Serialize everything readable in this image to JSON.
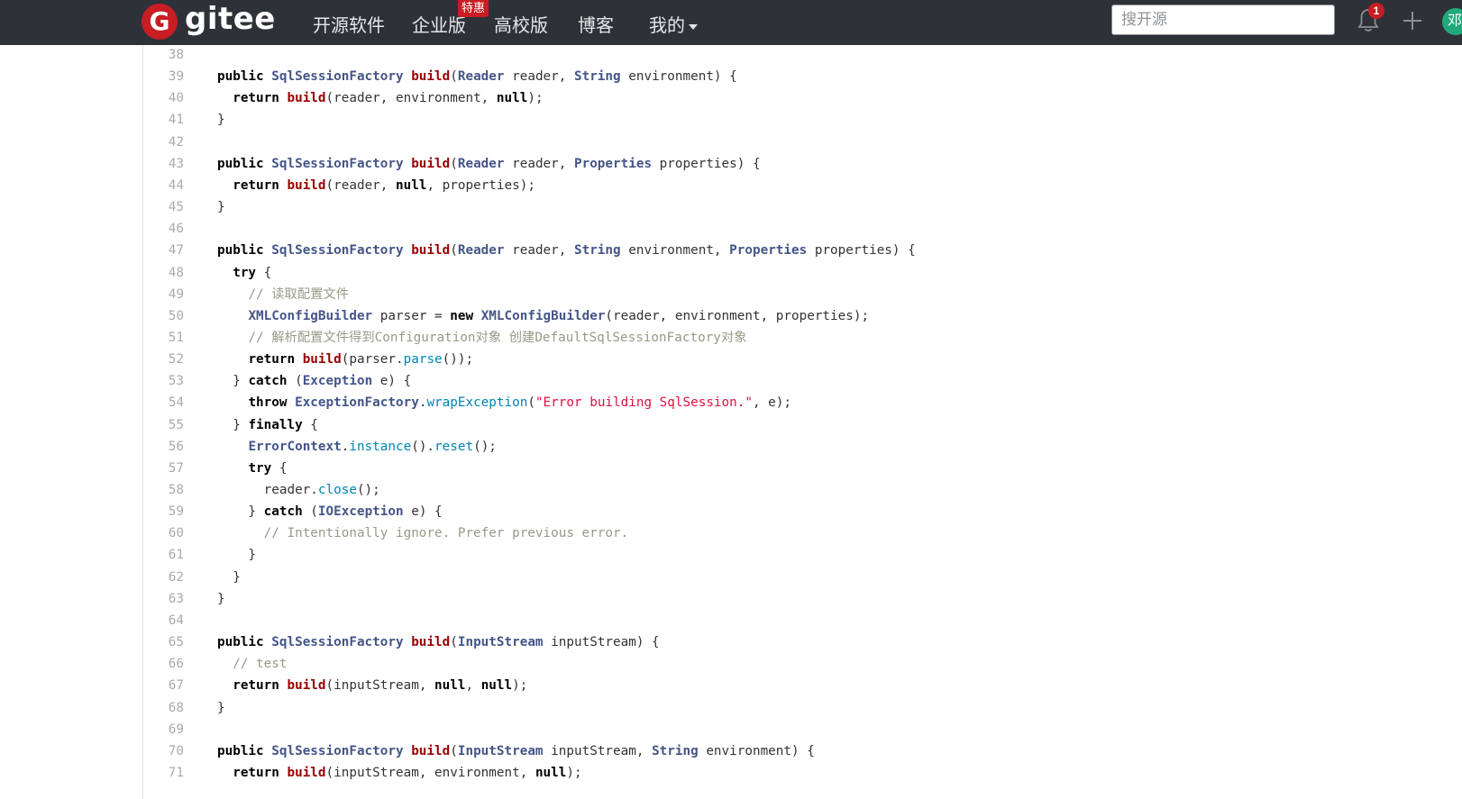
{
  "header": {
    "logo_letter": "G",
    "logo_text": "gitee",
    "nav": [
      "开源软件",
      "企业版",
      "高校版",
      "博客",
      "我的"
    ],
    "badge": "特惠",
    "search_placeholder": "搜开源",
    "notification_count": "1",
    "avatar_text": "邓"
  },
  "code": {
    "lines": [
      {
        "n": "38",
        "t": []
      },
      {
        "n": "39",
        "t": [
          [
            "kw",
            "public "
          ],
          [
            "ty",
            "SqlSessionFactory "
          ],
          [
            "fn",
            "build"
          ],
          [
            "",
            "("
          ],
          [
            "ty",
            "Reader"
          ],
          [
            "",
            " reader, "
          ],
          [
            "ty",
            "String"
          ],
          [
            "",
            " environment) {"
          ]
        ]
      },
      {
        "n": "40",
        "t": [
          [
            "",
            "  "
          ],
          [
            "kw",
            "return "
          ],
          [
            "fn",
            "build"
          ],
          [
            "",
            "(reader, environment, "
          ],
          [
            "kw",
            "null"
          ],
          [
            "",
            ");"
          ]
        ]
      },
      {
        "n": "41",
        "t": [
          [
            "",
            "}"
          ]
        ]
      },
      {
        "n": "42",
        "t": []
      },
      {
        "n": "43",
        "t": [
          [
            "kw",
            "public "
          ],
          [
            "ty",
            "SqlSessionFactory "
          ],
          [
            "fn",
            "build"
          ],
          [
            "",
            "("
          ],
          [
            "ty",
            "Reader"
          ],
          [
            "",
            " reader, "
          ],
          [
            "ty",
            "Properties"
          ],
          [
            "",
            " properties) {"
          ]
        ]
      },
      {
        "n": "44",
        "t": [
          [
            "",
            "  "
          ],
          [
            "kw",
            "return "
          ],
          [
            "fn",
            "build"
          ],
          [
            "",
            "(reader, "
          ],
          [
            "kw",
            "null"
          ],
          [
            "",
            ", properties);"
          ]
        ]
      },
      {
        "n": "45",
        "t": [
          [
            "",
            "}"
          ]
        ]
      },
      {
        "n": "46",
        "t": []
      },
      {
        "n": "47",
        "t": [
          [
            "kw",
            "public "
          ],
          [
            "ty",
            "SqlSessionFactory "
          ],
          [
            "fn",
            "build"
          ],
          [
            "",
            "("
          ],
          [
            "ty",
            "Reader"
          ],
          [
            "",
            " reader, "
          ],
          [
            "ty",
            "String"
          ],
          [
            "",
            " environment, "
          ],
          [
            "ty",
            "Properties"
          ],
          [
            "",
            " properties) {"
          ]
        ]
      },
      {
        "n": "48",
        "t": [
          [
            "",
            "  "
          ],
          [
            "kw",
            "try"
          ],
          [
            "",
            " {"
          ]
        ]
      },
      {
        "n": "49",
        "t": [
          [
            "",
            "    "
          ],
          [
            "cm",
            "// 读取配置文件"
          ]
        ]
      },
      {
        "n": "50",
        "t": [
          [
            "",
            "    "
          ],
          [
            "ty",
            "XMLConfigBuilder"
          ],
          [
            "",
            " parser = "
          ],
          [
            "kw",
            "new "
          ],
          [
            "ty",
            "XMLConfigBuilder"
          ],
          [
            "",
            "(reader, environment, properties);"
          ]
        ]
      },
      {
        "n": "51",
        "t": [
          [
            "",
            "    "
          ],
          [
            "cm",
            "// 解析配置文件得到Configuration对象 创建DefaultSqlSessionFactory对象"
          ]
        ]
      },
      {
        "n": "52",
        "t": [
          [
            "",
            "    "
          ],
          [
            "kw",
            "return "
          ],
          [
            "fn",
            "build"
          ],
          [
            "",
            "(parser."
          ],
          [
            "mt",
            "parse"
          ],
          [
            "",
            "());"
          ]
        ]
      },
      {
        "n": "53",
        "t": [
          [
            "",
            "  } "
          ],
          [
            "kw",
            "catch"
          ],
          [
            "",
            " ("
          ],
          [
            "ty",
            "Exception"
          ],
          [
            "",
            " e) {"
          ]
        ]
      },
      {
        "n": "54",
        "t": [
          [
            "",
            "    "
          ],
          [
            "kw",
            "throw "
          ],
          [
            "ty",
            "ExceptionFactory"
          ],
          [
            "",
            "."
          ],
          [
            "mt",
            "wrapException"
          ],
          [
            "",
            "("
          ],
          [
            "st",
            "\"Error building SqlSession.\""
          ],
          [
            "",
            ", e);"
          ]
        ]
      },
      {
        "n": "55",
        "t": [
          [
            "",
            "  } "
          ],
          [
            "kw",
            "finally"
          ],
          [
            "",
            " {"
          ]
        ]
      },
      {
        "n": "56",
        "t": [
          [
            "",
            "    "
          ],
          [
            "ty",
            "ErrorContext"
          ],
          [
            "",
            "."
          ],
          [
            "mt",
            "instance"
          ],
          [
            "",
            "()."
          ],
          [
            "mt",
            "reset"
          ],
          [
            "",
            "();"
          ]
        ]
      },
      {
        "n": "57",
        "t": [
          [
            "",
            "    "
          ],
          [
            "kw",
            "try"
          ],
          [
            "",
            " {"
          ]
        ]
      },
      {
        "n": "58",
        "t": [
          [
            "",
            "      reader."
          ],
          [
            "mt",
            "close"
          ],
          [
            "",
            "();"
          ]
        ]
      },
      {
        "n": "59",
        "t": [
          [
            "",
            "    } "
          ],
          [
            "kw",
            "catch"
          ],
          [
            "",
            " ("
          ],
          [
            "ty",
            "IOException"
          ],
          [
            "",
            " e) {"
          ]
        ]
      },
      {
        "n": "60",
        "t": [
          [
            "",
            "      "
          ],
          [
            "cm",
            "// Intentionally ignore. Prefer previous error."
          ]
        ]
      },
      {
        "n": "61",
        "t": [
          [
            "",
            "    }"
          ]
        ]
      },
      {
        "n": "62",
        "t": [
          [
            "",
            "  }"
          ]
        ]
      },
      {
        "n": "63",
        "t": [
          [
            "",
            "}"
          ]
        ]
      },
      {
        "n": "64",
        "t": []
      },
      {
        "n": "65",
        "t": [
          [
            "kw",
            "public "
          ],
          [
            "ty",
            "SqlSessionFactory "
          ],
          [
            "fn",
            "build"
          ],
          [
            "",
            "("
          ],
          [
            "ty",
            "InputStream"
          ],
          [
            "",
            " inputStream) {"
          ]
        ]
      },
      {
        "n": "66",
        "t": [
          [
            "",
            "  "
          ],
          [
            "cm",
            "// test"
          ]
        ]
      },
      {
        "n": "67",
        "t": [
          [
            "",
            "  "
          ],
          [
            "kw",
            "return "
          ],
          [
            "fn",
            "build"
          ],
          [
            "",
            "(inputStream, "
          ],
          [
            "kw",
            "null"
          ],
          [
            "",
            ", "
          ],
          [
            "kw",
            "null"
          ],
          [
            "",
            ");"
          ]
        ]
      },
      {
        "n": "68",
        "t": [
          [
            "",
            "}"
          ]
        ]
      },
      {
        "n": "69",
        "t": []
      },
      {
        "n": "70",
        "t": [
          [
            "kw",
            "public "
          ],
          [
            "ty",
            "SqlSessionFactory "
          ],
          [
            "fn",
            "build"
          ],
          [
            "",
            "("
          ],
          [
            "ty",
            "InputStream"
          ],
          [
            "",
            " inputStream, "
          ],
          [
            "ty",
            "String"
          ],
          [
            "",
            " environment) {"
          ]
        ]
      },
      {
        "n": "71",
        "t": [
          [
            "",
            "  "
          ],
          [
            "kw",
            "return "
          ],
          [
            "fn",
            "build"
          ],
          [
            "",
            "(inputStream, environment, "
          ],
          [
            "kw",
            "null"
          ],
          [
            "",
            ");"
          ]
        ]
      }
    ]
  }
}
